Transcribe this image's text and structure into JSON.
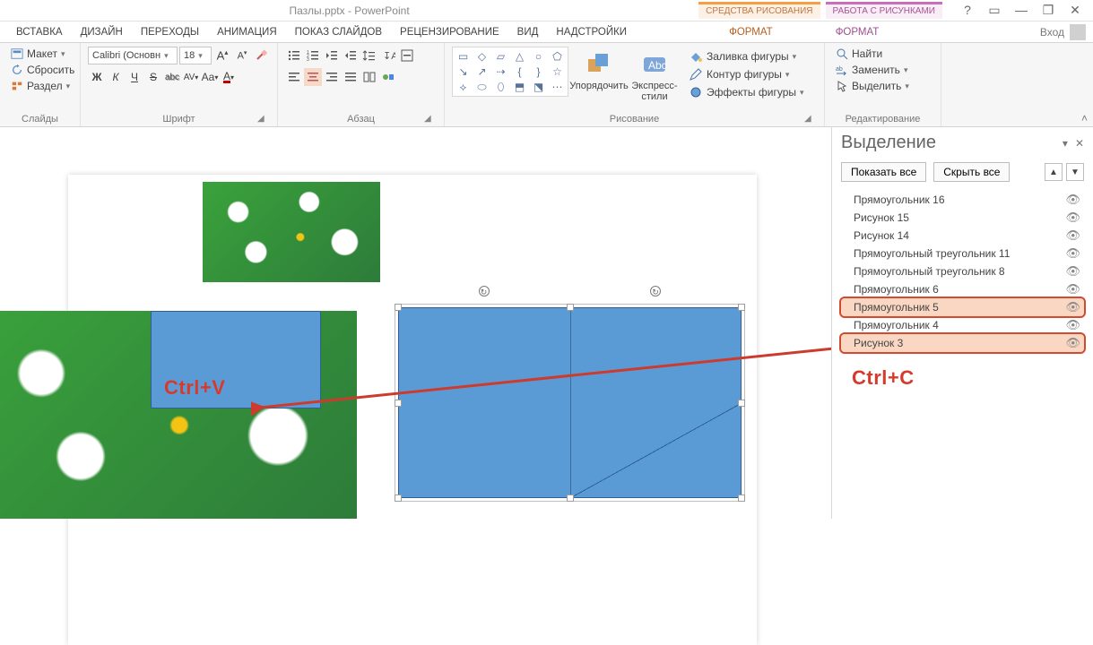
{
  "title": "Пазлы.pptx - PowerPoint",
  "context_tabs": {
    "drawing": "СРЕДСТВА РИСОВАНИЯ",
    "picture": "РАБОТА С РИСУНКАМИ"
  },
  "tabs": {
    "insert": "ВСТАВКА",
    "design": "ДИЗАЙН",
    "transitions": "ПЕРЕХОДЫ",
    "animations": "АНИМАЦИЯ",
    "slideshow": "ПОКАЗ СЛАЙДОВ",
    "review": "РЕЦЕНЗИРОВАНИЕ",
    "view": "ВИД",
    "addins": "НАДСТРОЙКИ",
    "format1": "ФОРМАТ",
    "format2": "ФОРМАТ",
    "signin": "Вход"
  },
  "ribbon": {
    "slides": {
      "group": "Слайды",
      "layout": "Макет",
      "reset": "Сбросить",
      "section": "Раздел"
    },
    "font": {
      "group": "Шрифт",
      "face": "Calibri (Основн",
      "size": "18",
      "bold": "Ж",
      "italic": "К",
      "underline": "Ч",
      "strike": "S",
      "shadow": "abc",
      "spacing": "AV",
      "case": "Aa",
      "color": "A"
    },
    "para": {
      "group": "Абзац"
    },
    "drawing": {
      "group": "Рисование",
      "arrange": "Упорядочить",
      "quick": "Экспресс-стили",
      "fill": "Заливка фигуры",
      "outline": "Контур фигуры",
      "effects": "Эффекты фигуры"
    },
    "editing": {
      "group": "Редактирование",
      "find": "Найти",
      "replace": "Заменить",
      "select": "Выделить"
    }
  },
  "annotations": {
    "ctrlv": "Ctrl+V",
    "ctrlc": "Ctrl+C"
  },
  "selection_pane": {
    "title": "Выделение",
    "show_all": "Показать все",
    "hide_all": "Скрыть все",
    "items": [
      {
        "label": "Прямоугольник 16",
        "selected": false,
        "boxed": false
      },
      {
        "label": "Рисунок 15",
        "selected": false,
        "boxed": false
      },
      {
        "label": "Рисунок 14",
        "selected": false,
        "boxed": false
      },
      {
        "label": "Прямоугольный треугольник 11",
        "selected": false,
        "boxed": false
      },
      {
        "label": "Прямоугольный треугольник 8",
        "selected": false,
        "boxed": false
      },
      {
        "label": "Прямоугольник 6",
        "selected": false,
        "boxed": false
      },
      {
        "label": "Прямоугольник 5",
        "selected": true,
        "boxed": true
      },
      {
        "label": "Прямоугольник 4",
        "selected": false,
        "boxed": false
      },
      {
        "label": "Рисунок 3",
        "selected": true,
        "boxed": true
      }
    ]
  }
}
